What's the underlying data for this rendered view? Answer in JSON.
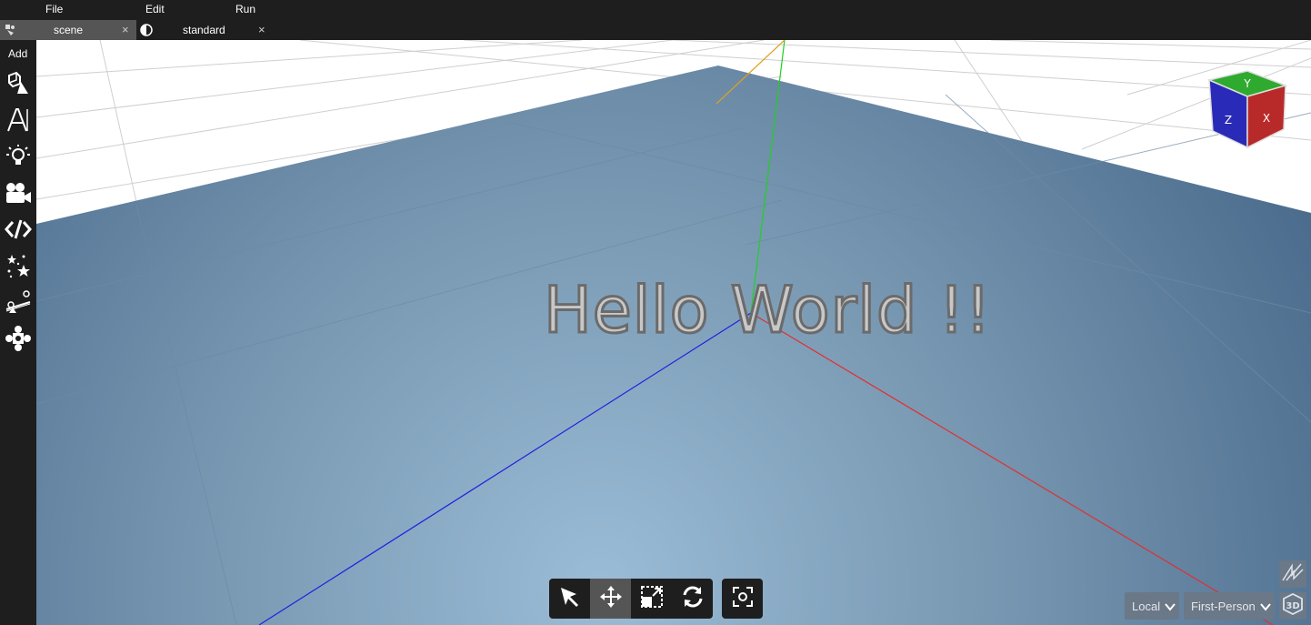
{
  "menu": {
    "file": "File",
    "edit": "Edit",
    "run": "Run"
  },
  "tabs": [
    {
      "label": "scene",
      "close": "×",
      "active": true,
      "icon": "scene-icon"
    },
    {
      "label": "standard",
      "close": "×",
      "active": false,
      "icon": "material-icon"
    }
  ],
  "toolbar": {
    "add_label": "Add",
    "tools": [
      "mesh-icon",
      "text-icon",
      "light-icon",
      "camera-icon",
      "script-icon",
      "particles-icon",
      "physics-icon",
      "gamepad-icon"
    ]
  },
  "viewport": {
    "text_object": "Hello World !!",
    "nav_cube_labels": {
      "top": "Y",
      "front": "Z",
      "right": "X"
    }
  },
  "transform_tools": [
    "select-icon",
    "move-icon",
    "scale-icon",
    "rotate-icon"
  ],
  "focus_tool": "focus-icon",
  "bottom_controls": {
    "space": "Local",
    "camera_mode": "First-Person"
  },
  "colors": {
    "x_axis": "#e03030",
    "y_axis": "#20d020",
    "z_axis": "#2020e0",
    "ground": "#5a7e9e",
    "panel_bg": "#1e1e1e"
  }
}
